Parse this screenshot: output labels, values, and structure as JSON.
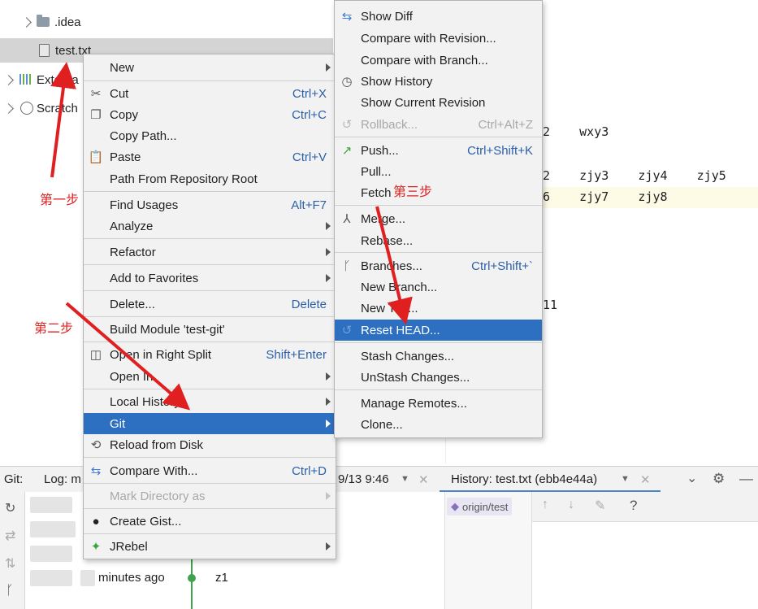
{
  "project_tree": {
    "items": [
      {
        "name": ".idea"
      },
      {
        "name": "test.txt"
      },
      {
        "name": "Externa"
      },
      {
        "name": "Scratch"
      }
    ]
  },
  "editor": {
    "line1": "2    wxy3",
    "line2": "2    zjy3    zjy4    zjy5",
    "line3": "6    zjy7    zjy8",
    "line4": "11"
  },
  "context_menu": {
    "new": "New",
    "cut": "Cut",
    "cut_sc": "Ctrl+X",
    "copy": "Copy",
    "copy_sc": "Ctrl+C",
    "copy_path": "Copy Path...",
    "paste": "Paste",
    "paste_sc": "Ctrl+V",
    "path_from_root": "Path From Repository Root",
    "find_usages": "Find Usages",
    "find_usages_sc": "Alt+F7",
    "analyze": "Analyze",
    "refactor": "Refactor",
    "add_fav": "Add to Favorites",
    "delete": "Delete...",
    "delete_sc": "Delete",
    "build_module": "Build Module 'test-git'",
    "open_right": "Open in Right Split",
    "open_right_sc": "Shift+Enter",
    "open_in": "Open In",
    "local_history": "Local History",
    "git": "Git",
    "reload": "Reload from Disk",
    "compare_with": "Compare With...",
    "compare_with_sc": "Ctrl+D",
    "mark_dir": "Mark Directory as",
    "create_gist": "Create Gist...",
    "jrebel": "JRebel"
  },
  "git_menu": {
    "show_diff": "Show Diff",
    "compare_revision": "Compare with Revision...",
    "compare_branch": "Compare with Branch...",
    "show_history": "Show History",
    "show_current": "Show Current Revision",
    "rollback": "Rollback...",
    "rollback_sc": "Ctrl+Alt+Z",
    "push": "Push...",
    "push_sc": "Ctrl+Shift+K",
    "pull": "Pull...",
    "fetch": "Fetch",
    "merge": "Merge...",
    "rebase": "Rebase...",
    "branches": "Branches...",
    "branches_sc": "Ctrl+Shift+`",
    "new_branch": "New Branch...",
    "new_tag": "New Tag...",
    "reset_head": "Reset HEAD...",
    "stash": "Stash Changes...",
    "unstash": "UnStash Changes...",
    "manage_remotes": "Manage Remotes...",
    "clone": "Clone..."
  },
  "bottom_panel": {
    "git_label": "Git:",
    "log_tab": "Log: m",
    "date_fragment": "9/13 9:46",
    "history_tab": "History: test.txt (ebb4e44a)",
    "origin_tag": "origin/test",
    "commit_time": "minutes ago",
    "commit_author": "z1"
  },
  "annotations": {
    "step1": "第一步",
    "step2": "第二步",
    "step3": "第三步"
  },
  "colors": {
    "accent": "#2d6fc1",
    "annotation": "#e02020"
  }
}
